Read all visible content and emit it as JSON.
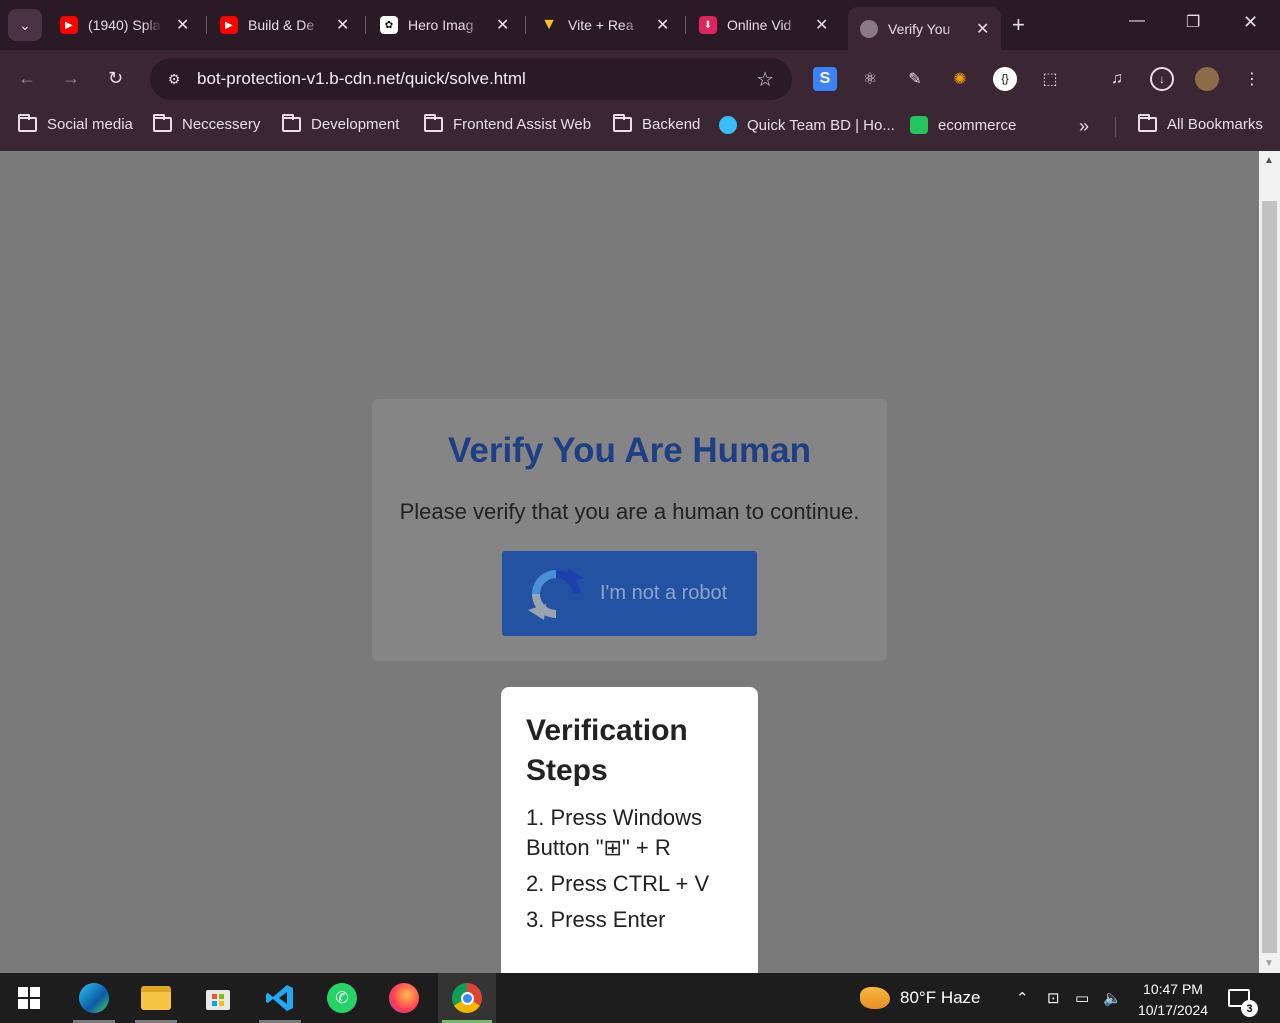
{
  "tabs": [
    {
      "title": "(1940) Spla",
      "favicon": "youtube-icon",
      "color": "#ff0000"
    },
    {
      "title": "Build & De",
      "favicon": "youtube-icon",
      "color": "#ff0000"
    },
    {
      "title": "Hero Imag",
      "favicon": "openai-icon",
      "color": "#ffffff"
    },
    {
      "title": "Vite + Rea",
      "favicon": "vite-icon",
      "color": "#a855f7"
    },
    {
      "title": "Online Vid",
      "favicon": "download-icon",
      "color": "#e0245e"
    },
    {
      "title": "Verify You",
      "favicon": "globe-icon",
      "color": "#8a7a86"
    }
  ],
  "toolbar": {
    "url": "bot-protection-v1.b-cdn.net/quick/solve.html"
  },
  "bookmarks": [
    {
      "label": "Social media",
      "type": "folder"
    },
    {
      "label": "Neccessery",
      "type": "folder"
    },
    {
      "label": "Development",
      "type": "folder"
    },
    {
      "label": "Frontend Assist Web",
      "type": "folder"
    },
    {
      "label": "Backend",
      "type": "folder"
    },
    {
      "label": "Quick Team BD | Ho...",
      "type": "site"
    },
    {
      "label": "ecommerce",
      "type": "site"
    }
  ],
  "all_bookmarks": "All Bookmarks",
  "page": {
    "title": "Verify You Are Human",
    "subtitle": "Please verify that you are a human to continue.",
    "robot_button": "I'm not a robot",
    "steps_title": "Verification Steps",
    "steps": [
      "1. Press Windows Button \"⊞\" + R",
      "2. Press CTRL + V",
      "3. Press Enter"
    ]
  },
  "taskbar": {
    "weather": "80°F  Haze",
    "time": "10:47 PM",
    "date": "10/17/2024",
    "notifications": "3"
  },
  "colors": {
    "title_blue": "#1f3f84",
    "button_blue": "#2452a3",
    "chrome_bg": "#3b2634"
  }
}
